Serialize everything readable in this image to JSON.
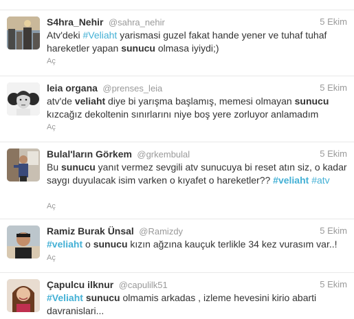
{
  "tweets": [
    {
      "fullname": "S4hra_Nehir",
      "handle": "@sahra_nehir",
      "time": "5 Ekim",
      "segments": [
        {
          "t": "Atv'deki ",
          "s": "n"
        },
        {
          "t": "#Veliaht",
          "s": "hl"
        },
        {
          "t": " yarismasi guzel fakat hande yener ve tuhaf tuhaf hareketler yapan ",
          "s": "n"
        },
        {
          "t": "sunucu",
          "s": "b"
        },
        {
          "t": " olmasa iyiydi;)",
          "s": "n"
        }
      ],
      "action": "Aç",
      "avatar": "city-rooftop-avatar"
    },
    {
      "fullname": "leia organa",
      "handle": "@prenses_leia",
      "time": "5 Ekim",
      "segments": [
        {
          "t": "atv'de ",
          "s": "n"
        },
        {
          "t": "veliaht",
          "s": "b"
        },
        {
          "t": " diye bi yarışma başlamış, memesi olmayan ",
          "s": "n"
        },
        {
          "t": "sunucu",
          "s": "b"
        },
        {
          "t": " kızcağız dekoltenin sınırlarını niye boş yere zorluyor anlamadım",
          "s": "n"
        }
      ],
      "action": "Aç",
      "avatar": "princess-leia-avatar"
    },
    {
      "fullname": "Bulal'ların Görkem",
      "handle": "@grkembulal",
      "time": "5 Ekim",
      "segments": [
        {
          "t": "Bu ",
          "s": "n"
        },
        {
          "t": "sunucu",
          "s": "b"
        },
        {
          "t": " yanıt vermez sevgili atv sunucuya bi reset atın siz, o kadar saygı duyulacak isim varken o kıyafet o hareketler?? ",
          "s": "n"
        },
        {
          "t": "#veliaht",
          "s": "tag"
        },
        {
          "t": " ",
          "s": "n"
        },
        {
          "t": "#atv",
          "s": "hl"
        }
      ],
      "action": "Aç",
      "avatar": "person-in-room-avatar"
    },
    {
      "fullname": "Ramiz Burak Ünsal",
      "handle": "@Ramizdy",
      "time": "5 Ekim",
      "segments": [
        {
          "t": "#veliaht",
          "s": "tag"
        },
        {
          "t": " o ",
          "s": "n"
        },
        {
          "t": "sunucu",
          "s": "b"
        },
        {
          "t": " kızın ağzına kauçuk terlikle 34 kez vurasım var..!",
          "s": "n"
        }
      ],
      "action": "Aç",
      "avatar": "young-man-avatar"
    },
    {
      "fullname": "Çapulcu ilknur",
      "handle": "@capulilk51",
      "time": "5 Ekim",
      "segments": [
        {
          "t": "#Veliaht",
          "s": "tag"
        },
        {
          "t": " ",
          "s": "n"
        },
        {
          "t": "sunucu",
          "s": "b"
        },
        {
          "t": " olmamis arkadas , izleme hevesini kirio abarti davranislari...",
          "s": "n"
        }
      ],
      "action": "",
      "avatar": "woman-smiling-avatar"
    }
  ]
}
